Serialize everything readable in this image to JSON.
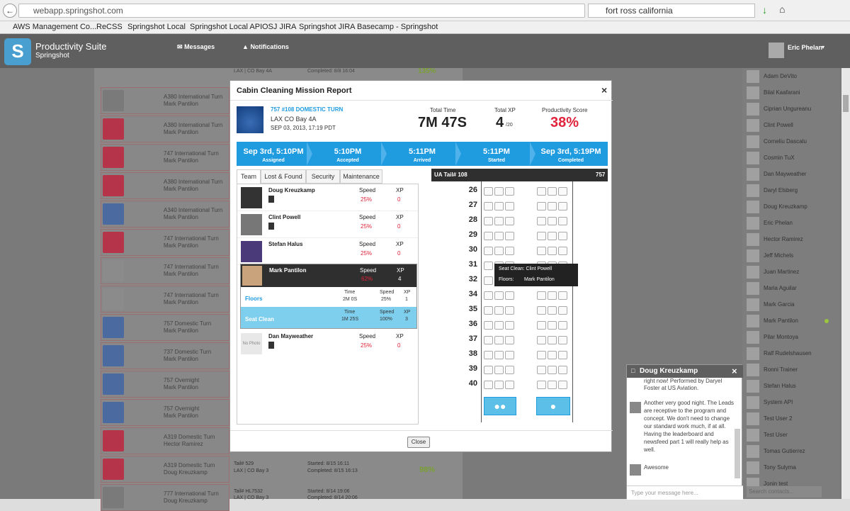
{
  "browser": {
    "url": "webapp.springshot.com",
    "search": "fort ross california",
    "bookmarks": [
      "AWS Management Co...",
      "ReCSS",
      "Springshot Local",
      "Springshot Local API",
      "OSJ JIRA",
      "Springshot JIRA",
      "Basecamp - Springshot"
    ]
  },
  "app": {
    "logo_letter": "S",
    "title": "Productivity Suite",
    "subtitle": "Springshot",
    "nav_messages": "Messages",
    "nav_notifications": "Notifications",
    "user_name": "Eric Phelan"
  },
  "background_list": [
    {
      "title": "A380 International Turn",
      "sub": "Mark Pantilon",
      "logo_color": "#7a7a7a"
    },
    {
      "title": "A380 International Turn",
      "sub": "Mark Pantilon",
      "logo_color": "#b5344a"
    },
    {
      "title": "747 International Turn",
      "sub": "Mark Pantilon",
      "logo_color": "#b5344a"
    },
    {
      "title": "A380 International Turn",
      "sub": "Mark Pantilon",
      "logo_color": "#b5344a"
    },
    {
      "title": "A340 International Turn",
      "sub": "Mark Pantilon",
      "logo_color": "#4a6aa0"
    },
    {
      "title": "747 International Turn",
      "sub": "Mark Pantilon",
      "logo_color": "#b5344a"
    },
    {
      "title": "747 International Turn",
      "sub": "Mark Pantilon",
      "logo_color": "#8b8b8b"
    },
    {
      "title": "747 International Turn",
      "sub": "Mark Pantilon",
      "logo_color": "#8b8b8b"
    },
    {
      "title": "757 Domestic Turn",
      "sub": "Mark Pantilon",
      "logo_color": "#4a6aa0"
    },
    {
      "title": "737 Domestic Turn",
      "sub": "Mark Pantilon",
      "logo_color": "#4a6aa0"
    },
    {
      "title": "757 Overnight",
      "sub": "Mark Pantilon",
      "logo_color": "#4a6aa0"
    },
    {
      "title": "757 Overnight",
      "sub": "Mark Pantilon",
      "logo_color": "#4a6aa0"
    },
    {
      "title": "A319 Domestic Turn",
      "sub": "Hector Ramirez",
      "logo_color": "#b5344a"
    },
    {
      "title": "A319 Domestic Turn",
      "sub": "Doug Kreuzkamp",
      "logo_color": "#b5344a"
    },
    {
      "title": "777 International Turn",
      "sub": "Doug Kreuzkamp",
      "logo_color": "#7a7a7a"
    }
  ],
  "background_extra": {
    "row13_tail": "Tail# 529",
    "row13_loc": "LAX | CO Bay 3",
    "row13_started": "Started: 8/15 16:11",
    "row13_completed": "Completed: 8/15 16:13",
    "row13_score": "98%",
    "row14_tail": "Tail# HL7532",
    "row14_loc": "LAX | CO Bay 3",
    "row14_started": "Started: 8/14 19:06",
    "row14_completed": "Completed: 8/14 20:06",
    "top_loc": "LAX | CO Bay 4A",
    "top_completed": "Completed: 8/8 16:04",
    "top_score": "135%"
  },
  "contacts": [
    "Adam DeVito",
    "Bilal Kaafarani",
    "Ciprian Ungureanu",
    "Clint Powell",
    "Corneliu Dascalu",
    "Cosmin TuX",
    "Dan Mayweather",
    "Daryl Elsberg",
    "Doug Kreuzkamp",
    "Eric Phelan",
    "Hector Ramirez",
    "Jeff Michels",
    "Juan Martinez",
    "Maria Aguilar",
    "Mark Garcia",
    "Mark Pantilon",
    "Pilar Montoya",
    "Ralf Rudelshausen",
    "Ronni Trainer",
    "Stefan Halus",
    "System API",
    "Test User 2",
    "Test User",
    "Tomas Gutierrez",
    "Tony Sulyma",
    "Jonin test"
  ],
  "contacts_search_placeholder": "Search contacts...",
  "modal": {
    "title": "Cabin Cleaning Mission Report",
    "close_x": "×",
    "flight": "757 #108 DOMESTIC TURN",
    "location": "LAX CO Bay 4A",
    "date": "SEP 03, 2013, 17:19 PDT",
    "total_time_label": "Total Time",
    "total_time": "7M 47S",
    "total_xp_label": "Total XP",
    "total_xp": "4",
    "total_xp_max": "/20",
    "score_label": "Productivity Score",
    "score": "38%",
    "steps": [
      {
        "time": "Sep 3rd, 5:10PM",
        "label": "Assigned"
      },
      {
        "time": "5:10PM",
        "label": "Accepted"
      },
      {
        "time": "5:11PM",
        "label": "Arrived"
      },
      {
        "time": "5:11PM",
        "label": "Started"
      },
      {
        "time": "Sep 3rd, 5:19PM",
        "label": "Completed"
      }
    ],
    "tabs": [
      "Team",
      "Lost & Found",
      "Security",
      "Maintenance"
    ],
    "speed_label": "Speed",
    "xp_label": "XP",
    "time_label": "Time",
    "members": [
      {
        "name": "Doug Kreuzkamp",
        "speed": "25%",
        "xp": "0"
      },
      {
        "name": "Clint Powell",
        "speed": "25%",
        "xp": "0"
      },
      {
        "name": "Stefan Halus",
        "speed": "25%",
        "xp": "0"
      }
    ],
    "selected_member": {
      "name": "Mark Pantilon",
      "speed": "62%",
      "xp": "4"
    },
    "tasks": [
      {
        "name": "Floors",
        "time": "2M 0S",
        "speed": "25%",
        "xp": "1"
      },
      {
        "name": "Seat Clean",
        "time": "1M 25S",
        "speed": "100%",
        "xp": "3"
      }
    ],
    "last_member": {
      "name": "Dan Mayweather",
      "speed": "25%",
      "xp": "0",
      "photo_text": "No Photo"
    },
    "plane_label": "UA Tail# 108",
    "plane_type": "757",
    "rows": [
      "26",
      "27",
      "28",
      "29",
      "30",
      "31",
      "32",
      "34",
      "35",
      "36",
      "37",
      "38",
      "39",
      "40"
    ],
    "tooltip_line1": "Seat Clean: Clint Powell",
    "tooltip_floors": "Floors:",
    "tooltip_floors_val": "Mark Pantilon",
    "close_button": "Close"
  },
  "chat": {
    "title": "Doug Kreuzkamp",
    "msg_top": "right now! Performed by Daryel Foster at US Aviation.",
    "msg1": "Another very good night. The Leads are receptive to the program and concept. We don't need to change our standard work much, if at all. Having the leaderboard and newsfeed part 1 will really help as well.",
    "msg2": "Awesome",
    "placeholder": "Type your message here..."
  },
  "colors": {
    "accent": "#1f9be0",
    "danger": "#e0233a",
    "header": "#5f5f5f"
  }
}
